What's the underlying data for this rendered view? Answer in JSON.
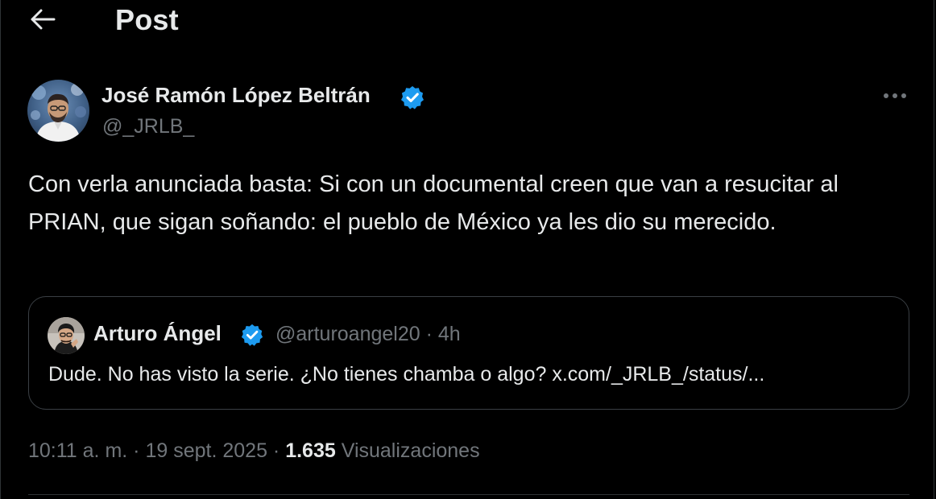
{
  "header": {
    "title": "Post",
    "back_icon": "arrow-left-icon"
  },
  "post": {
    "author": {
      "name": "José Ramón López Beltrán",
      "handle": "@_JRLB_",
      "verified": true,
      "avatar_icon": "profile-photo"
    },
    "more_icon": "more-horizontal-icon",
    "text": "Con verla anunciada basta: Si con un documental creen que van a resucitar al PRIAN, que sigan soñando: el pueblo de México ya les dio su merecido.",
    "quote": {
      "name": "Arturo Ángel",
      "handle": "@arturoangel20",
      "time": "4h",
      "verified": true,
      "text": "Dude. No has visto la serie. ¿No tienes chamba o algo? x.com/_JRLB_/status/..."
    },
    "meta": {
      "time": "10:11 a. m.",
      "date": "19 sept. 2025",
      "views_count": "1.635",
      "views_label": "Visualizaciones",
      "separator": "·"
    }
  },
  "colors": {
    "background": "#000000",
    "text_primary": "#e7e9ea",
    "text_secondary": "#71767b",
    "verified_blue": "#1d9bf0",
    "border": "#2f3336"
  }
}
